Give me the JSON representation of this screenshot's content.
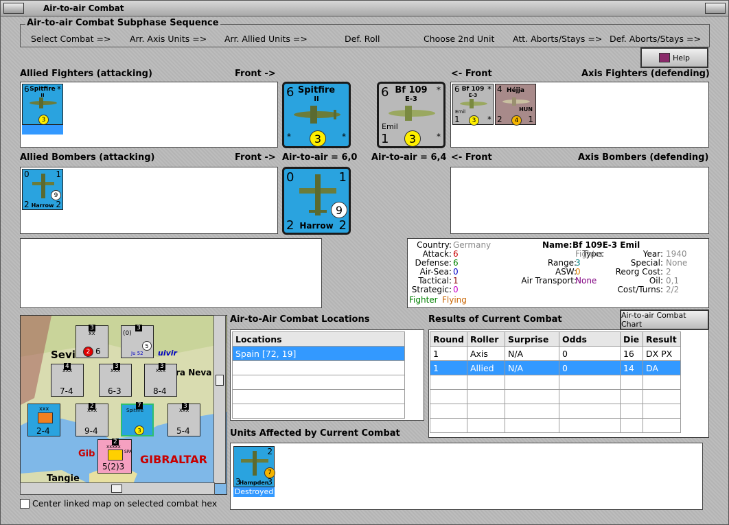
{
  "window": {
    "title": "Air-to-air Combat"
  },
  "sequence": {
    "title": "Air-to-air Combat Subphase Sequence",
    "steps": [
      "Select Combat =>",
      "Arr. Axis Units =>",
      "Arr. Allied Units =>",
      "Def. Roll",
      "Choose 2nd Unit",
      "Att. Aborts/Stays =>",
      "Def. Aborts/Stays =>"
    ]
  },
  "help_button": {
    "label": "Help"
  },
  "labels": {
    "allied_fighters": "Allied Fighters (attacking)",
    "front_right_1": "Front ->",
    "front_left_1": "<- Front",
    "axis_fighters": "Axis Fighters (defending)",
    "allied_bombers": "Allied Bombers (attacking)",
    "front_right_2": "Front ->",
    "allied_a2a": "Air-to-air = 6,0",
    "axis_a2a": "Air-to-air = 6,4",
    "front_left_2": "<- Front",
    "axis_bombers": "Axis Bombers (defending)",
    "locations_title": "Air-to-Air Combat Locations",
    "results_title": "Results of Current Combat",
    "affected_title": "Units Affected by Current Combat",
    "center_checkbox": "Center linked map on selected combat hex",
    "combat_chart_button": "Air-to-air Combat Chart"
  },
  "counters": {
    "spitfire_small": {
      "top_left": "6",
      "name": "Spitfire",
      "sub": "II",
      "circle": "3",
      "star": "*"
    },
    "spitfire_big": {
      "top_left": "6",
      "name": "Spitfire",
      "sub": "II",
      "circle": "3",
      "star": "*"
    },
    "bf109_big": {
      "top_left": "6",
      "name": "Bf 109",
      "sub": "E-3",
      "bottom_name": "Emil",
      "bottom_left": "1",
      "circle": "3",
      "star": "*"
    },
    "bf109_small": {
      "top_left": "6",
      "name": "Bf 109",
      "sub": "E-3",
      "bottom_name": "Emil",
      "bottom_left": "1",
      "circle": "3",
      "star": "*"
    },
    "hejja_small": {
      "top_left": "4",
      "name": "Héjja",
      "sub": "HUN",
      "bottom_left": "2",
      "circle": "4",
      "bottom_right": "1"
    },
    "harrow_small": {
      "top_left": "0",
      "top_right": "1",
      "bottom_left": "2",
      "bottom_right": "2",
      "name": "Harrow",
      "circle": "9"
    },
    "harrow_big": {
      "top_left": "0",
      "top_right": "1",
      "bottom_left": "2",
      "bottom_right": "2",
      "name": "Harrow",
      "circle": "9"
    },
    "hampden": {
      "top_right": "2",
      "bottom_left": "3",
      "bottom_right": "3",
      "name": "Hampden",
      "circle": "7",
      "status": "Destroyed"
    }
  },
  "unit_info": {
    "country_label": "Country:",
    "country": "Germany",
    "attack_label": "Attack:",
    "attack": "6",
    "defense_label": "Defense:",
    "defense": "6",
    "airsea_label": "Air-Sea:",
    "airsea": "0",
    "tactical_label": "Tactical:",
    "tactical": "1",
    "strategic_label": "Strategic:",
    "strategic": "0",
    "status_a": "Fighter",
    "status_b": "Flying",
    "name_label": "Name:",
    "name": "Bf 109E-3 Emil",
    "type_label": "Type:",
    "type": "Fighter",
    "range_label": "Range:",
    "range": "3",
    "asw_label": "ASW:",
    "asw": "0",
    "air_transport_label": "Air Transport:",
    "air_transport": "None",
    "year_label": "Year:",
    "year": "1940",
    "special_label": "Special:",
    "special": "None",
    "reorg_label": "Reorg Cost:",
    "reorg": "2",
    "oil_label": "Oil:",
    "oil": "0,1",
    "costturns_label": "Cost/Turns:",
    "costturns": "2/2"
  },
  "locations": {
    "header": "Locations",
    "rows": [
      "Spain [72, 19]",
      "",
      "",
      "",
      "",
      ""
    ]
  },
  "results": {
    "headers": [
      "Round",
      "Roller",
      "Surprise",
      "Odds",
      "Die",
      "Result"
    ],
    "rows": [
      [
        "1",
        "Axis",
        "N/A",
        "0",
        "16",
        "DX PX"
      ],
      [
        "1",
        "Allied",
        "N/A",
        "0",
        "14",
        "DA"
      ],
      [
        "",
        "",
        "",
        "",
        "",
        ""
      ],
      [
        "",
        "",
        "",
        "",
        "",
        ""
      ],
      [
        "",
        "",
        "",
        "",
        "",
        ""
      ],
      [
        "",
        "",
        "",
        "",
        "",
        ""
      ]
    ]
  },
  "map": {
    "labels": {
      "sevilla": "Sevi",
      "sierra": "ra Neva",
      "guad": "uivir",
      "gib_small": "Gib",
      "gibraltar": "GIBRALTAR",
      "tangier": "Tangie"
    },
    "units": [
      {
        "top": "3",
        "name": "xx",
        "value": "6",
        "circle": "2"
      },
      {
        "top": "3",
        "name": "(0)",
        "sub": "Ju 52",
        "circle": "5"
      },
      {
        "top": "4",
        "name": "xxx",
        "value": "7-4"
      },
      {
        "top": "3",
        "name": "xxx",
        "value": "6-3"
      },
      {
        "top": "3",
        "name": "xxx",
        "value": "8-4"
      },
      {
        "top": "",
        "name": "xxx",
        "value": "2-4"
      },
      {
        "top": "2",
        "name": "xxx",
        "value": "9-4"
      },
      {
        "top": "7",
        "name": "Spitfire",
        "circle": "3"
      },
      {
        "top": "3",
        "name": "xxx",
        "value": "5-4"
      },
      {
        "top": "2",
        "name": "xxxxx",
        "value": "5(2)3",
        "side": "SPA"
      }
    ]
  },
  "colors": {
    "accent": "#3399ff",
    "counter_blue": "#2aa3df",
    "counter_gray": "#b9b9b9",
    "counter_pink": "#a88a8a",
    "yellow": "#ffef00"
  }
}
